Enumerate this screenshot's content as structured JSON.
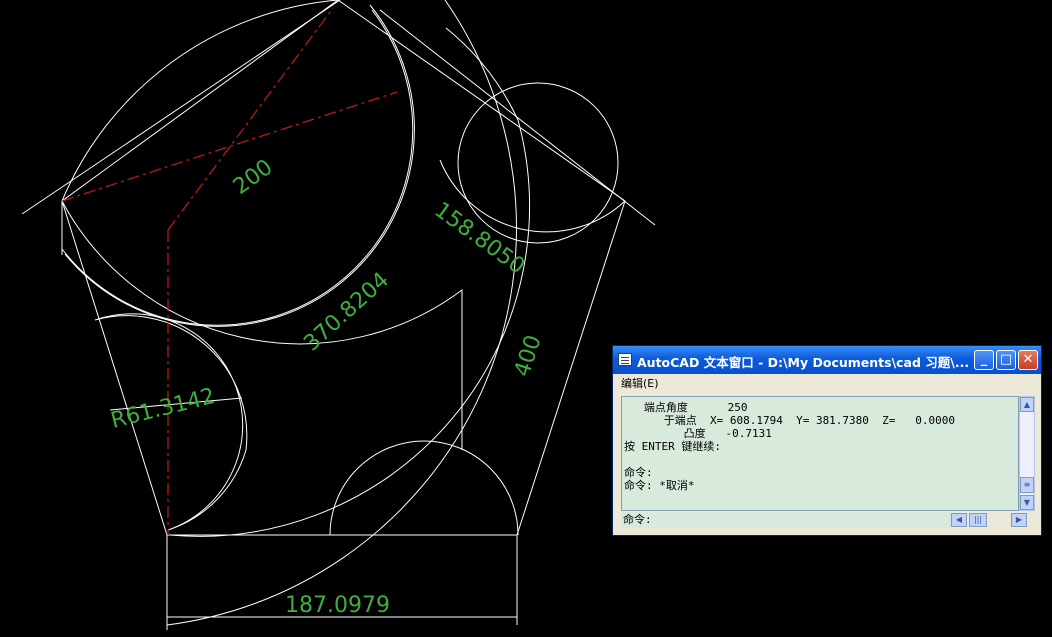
{
  "drawing": {
    "dimensions": {
      "d200": "200",
      "d158": "158.8050",
      "d370": "370.8204",
      "d400": "400",
      "radius": "R61.3142",
      "bottom": "187.0979"
    }
  },
  "text_window": {
    "title": "AutoCAD 文本窗口 - D:\\My Documents\\cad 习题\\...",
    "menu": "编辑(E)",
    "lines": [
      "   端点角度      250",
      "      于端点  X= 608.1794  Y= 381.7380  Z=   0.0000",
      "         凸度   -0.7131",
      "按 ENTER 键继续:",
      "",
      "命令:",
      "命令: *取消*"
    ],
    "prompt": "命令:"
  },
  "colors": {
    "geometry": "#ffffff",
    "center_line": "#c41a1a",
    "dimension": "#3fae3f"
  }
}
